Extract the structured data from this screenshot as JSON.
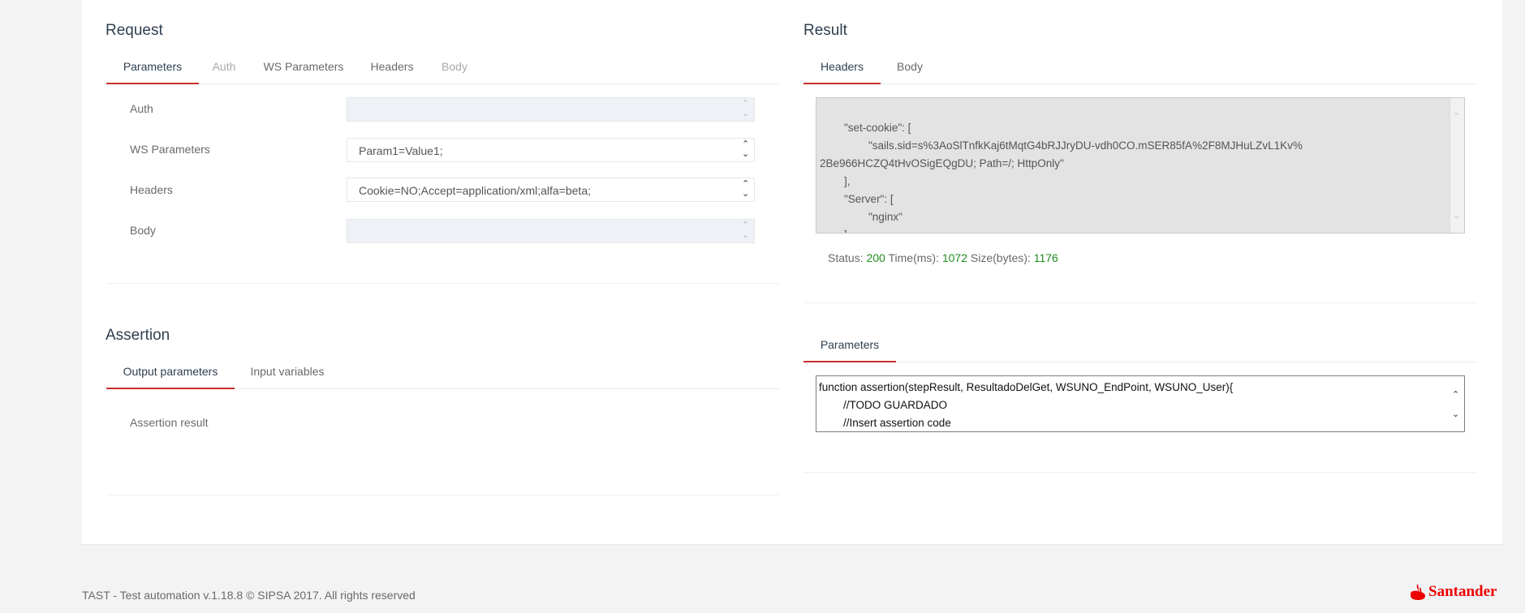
{
  "request": {
    "title": "Request",
    "tabs": [
      "Parameters",
      "Auth",
      "WS Parameters",
      "Headers",
      "Body"
    ],
    "rows": [
      {
        "label": "Auth",
        "value": ""
      },
      {
        "label": "WS Parameters",
        "value": "Param1=Value1;"
      },
      {
        "label": "Headers",
        "value": "Cookie=NO;Accept=application/xml;alfa=beta;"
      },
      {
        "label": "Body",
        "value": ""
      }
    ]
  },
  "assertion": {
    "title": "Assertion",
    "tabs": [
      "Output parameters",
      "Input variables"
    ],
    "result_label": "Assertion result"
  },
  "result": {
    "title": "Result",
    "tabs": [
      "Headers",
      "Body"
    ],
    "lines": [
      "        \"set-cookie\": [",
      "                \"sails.sid=s%3AoSlTnfkKaj6tMqtG4bRJJryDU-vdh0CO.mSER85fA%2F8MJHuLZvL1Kv%",
      "2Be966HCZQ4tHvOSigEQgDU; Path=/; HttpOnly\"",
      "        ],",
      "        \"Server\": [",
      "                \"nginx\"",
      "        ]"
    ],
    "status_label": "Status:",
    "status": "200",
    "time_label": "Time(ms):",
    "time": "1072",
    "size_label": "Size(bytes):",
    "size": "1176"
  },
  "parameters": {
    "tab": "Parameters",
    "code_lines": [
      "function assertion(stepResult, ResultadoDelGet, WSUNO_EndPoint, WSUNO_User){",
      "        //TODO GUARDADO",
      "        //Insert assertion code"
    ]
  },
  "footer": {
    "text": "TAST - Test automation v.1.18.8 © SIPSA 2017. All rights reserved",
    "logo_text": "Santander"
  },
  "colors": {
    "accent": "#c9302c",
    "status_value": "#1f8c1f",
    "brand_red": "#ec0000"
  }
}
